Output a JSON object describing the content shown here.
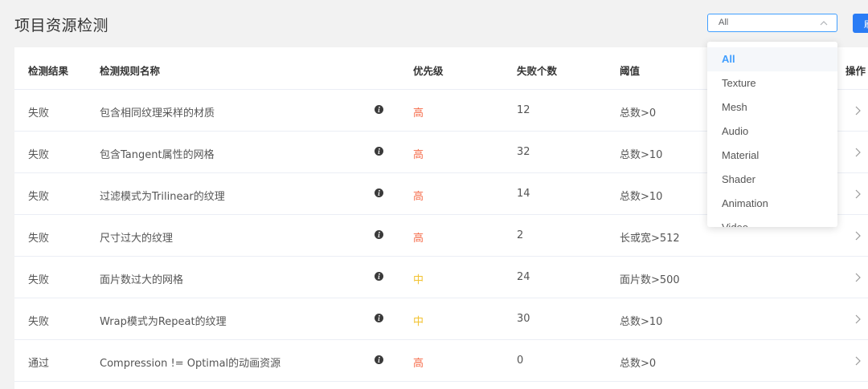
{
  "header": {
    "title": "项目资源检测",
    "filter_value": "All",
    "button_label": "刷"
  },
  "table": {
    "columns": [
      "检测结果",
      "检测规则名称",
      "优先级",
      "失败个数",
      "阈值",
      "操作"
    ],
    "rows": [
      {
        "result": "失败",
        "name": "包含相同纹理采样的材质",
        "priority": "高",
        "fail_count": "12",
        "threshold": "总数>0"
      },
      {
        "result": "失败",
        "name": "包含Tangent属性的网格",
        "priority": "高",
        "fail_count": "32",
        "threshold": "总数>10"
      },
      {
        "result": "失败",
        "name": "过滤模式为Trilinear的纹理",
        "priority": "高",
        "fail_count": "14",
        "threshold": "总数>10"
      },
      {
        "result": "失败",
        "name": "尺寸过大的纹理",
        "priority": "高",
        "fail_count": "2",
        "threshold": "长或宽>512"
      },
      {
        "result": "失败",
        "name": "面片数过大的网格",
        "priority": "中",
        "fail_count": "24",
        "threshold": "面片数>500"
      },
      {
        "result": "失败",
        "name": "Wrap模式为Repeat的纹理",
        "priority": "中",
        "fail_count": "30",
        "threshold": "总数>10"
      },
      {
        "result": "通过",
        "name": "Compression != Optimal的动画资源",
        "priority": "高",
        "fail_count": "0",
        "threshold": "总数>0"
      }
    ]
  },
  "dropdown": {
    "options": [
      "All",
      "Texture",
      "Mesh",
      "Audio",
      "Material",
      "Shader",
      "Animation",
      "Video"
    ],
    "selected": "All"
  },
  "colors": {
    "priority_high": "#f56c4a",
    "priority_mid": "#f2c230",
    "accent": "#409eff",
    "button": "#2a7cf5"
  },
  "icons": {
    "info": "info-icon",
    "row_action": "chevron-right-icon",
    "select_toggle": "chevron-up-icon"
  }
}
